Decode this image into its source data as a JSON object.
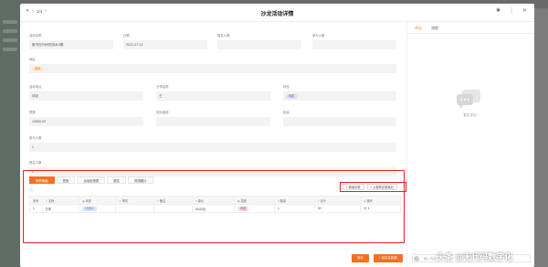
{
  "header": {
    "page_indicator": "1/4",
    "title": "沙龙活动详情"
  },
  "form": {
    "activity_name": {
      "label": "活动名称",
      "value": "服书无代码的流水3期"
    },
    "date": {
      "label": "日期",
      "value": "2021-07-14"
    },
    "report_count": {
      "label": "报名人数",
      "value": ""
    },
    "attend_count": {
      "label": "参与人数",
      "value": ""
    },
    "site": {
      "label": "地区",
      "value": "深圳"
    },
    "activity_status": {
      "label": "活动地点",
      "value": "待定"
    },
    "owner": {
      "label": "分享嘉宾",
      "value": "王"
    },
    "state": {
      "label": "状态",
      "value": "待定"
    },
    "budget": {
      "label": "预算",
      "value": "13000.00"
    },
    "actual_cost": {
      "label": "实际费用",
      "value": ""
    },
    "balance": {
      "label": "结余",
      "value": ""
    },
    "participants": {
      "label": "参与人数",
      "value": "1"
    },
    "signups": {
      "label": "报名人数",
      "value": "2"
    }
  },
  "detail": {
    "tabs": [
      "采购明细",
      "签到",
      "活动反馈表",
      "报名",
      "现场照片"
    ],
    "buttons": [
      "+ 新增记录",
      "+ 从现有记录添加"
    ],
    "columns": [
      "序号",
      "名称",
      "状态",
      "附件",
      "备注",
      "单价",
      "类型",
      "数量",
      "合计",
      "操作"
    ],
    "rows": [
      {
        "idx": "1",
        "name": "打车",
        "status": "计划中",
        "attachment": "",
        "note": "",
        "price": "50.00元",
        "type": "待选",
        "qty": "1",
        "total": "50",
        "action": "1"
      }
    ]
  },
  "bottom": {
    "save": "保存",
    "save_next": "+ 保存并新建"
  },
  "comments": {
    "tabs": [
      "评论",
      "流程"
    ],
    "empty": "暂无评论~",
    "input_placeholder": "输入内容"
  },
  "watermark": "头条 @无代码数字化",
  "colors": {
    "accent": "#f37021",
    "highlight_box": "#e02020"
  }
}
